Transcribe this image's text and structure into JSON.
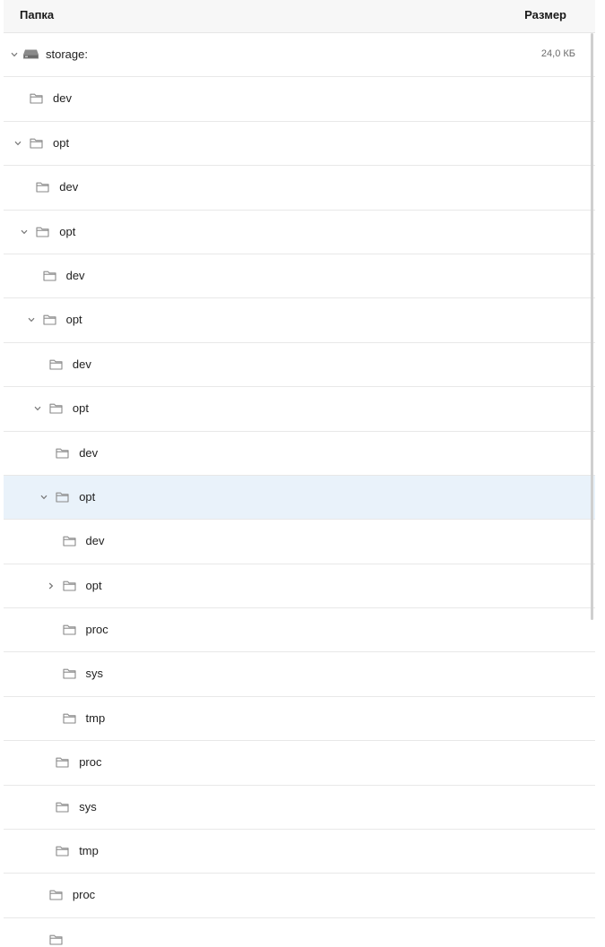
{
  "header": {
    "folder_col": "Папка",
    "size_col": "Размер"
  },
  "rows": [
    {
      "name": "storage:",
      "icon": "drive-icon",
      "depth": 0,
      "expander": "expanded",
      "size": "24,0 КБ"
    },
    {
      "name": "dev",
      "icon": "folder-icon",
      "depth": 1,
      "expander": "none"
    },
    {
      "name": "opt",
      "icon": "folder-icon",
      "depth": 1,
      "expander": "expanded"
    },
    {
      "name": "dev",
      "icon": "folder-icon",
      "depth": 2,
      "expander": "none"
    },
    {
      "name": "opt",
      "icon": "folder-icon",
      "depth": 2,
      "expander": "expanded"
    },
    {
      "name": "dev",
      "icon": "folder-icon",
      "depth": 3,
      "expander": "none"
    },
    {
      "name": "opt",
      "icon": "folder-icon",
      "depth": 3,
      "expander": "expanded"
    },
    {
      "name": "dev",
      "icon": "folder-icon",
      "depth": 4,
      "expander": "none"
    },
    {
      "name": "opt",
      "icon": "folder-icon",
      "depth": 4,
      "expander": "expanded"
    },
    {
      "name": "dev",
      "icon": "folder-icon",
      "depth": 5,
      "expander": "none"
    },
    {
      "name": "opt",
      "icon": "folder-icon",
      "depth": 5,
      "expander": "expanded",
      "selected": true
    },
    {
      "name": "dev",
      "icon": "folder-icon",
      "depth": 6,
      "expander": "none"
    },
    {
      "name": "opt",
      "icon": "folder-icon",
      "depth": 6,
      "expander": "collapsed"
    },
    {
      "name": "proc",
      "icon": "folder-icon",
      "depth": 6,
      "expander": "none"
    },
    {
      "name": "sys",
      "icon": "folder-icon",
      "depth": 6,
      "expander": "none"
    },
    {
      "name": "tmp",
      "icon": "folder-icon",
      "depth": 6,
      "expander": "none"
    },
    {
      "name": "proc",
      "icon": "folder-icon",
      "depth": 5,
      "expander": "none"
    },
    {
      "name": "sys",
      "icon": "folder-icon",
      "depth": 5,
      "expander": "none"
    },
    {
      "name": "tmp",
      "icon": "folder-icon",
      "depth": 5,
      "expander": "none"
    },
    {
      "name": "proc",
      "icon": "folder-icon",
      "depth": 4,
      "expander": "none"
    },
    {
      "name": "",
      "icon": "folder-icon",
      "depth": 4,
      "expander": "none"
    }
  ]
}
